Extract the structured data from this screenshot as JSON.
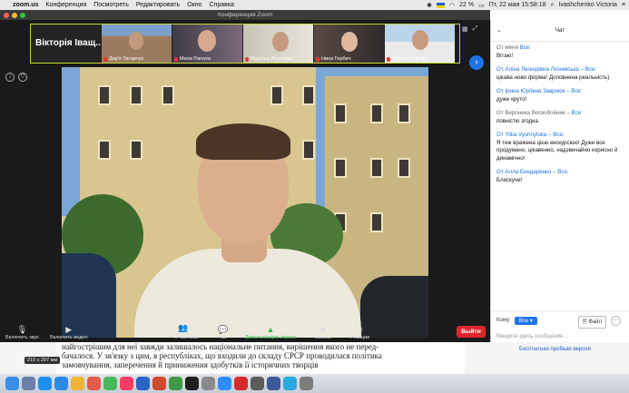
{
  "menubar": {
    "app": "zoom.us",
    "items": [
      "Конференция",
      "Посмотреть",
      "Редактировать",
      "Окно",
      "Справка"
    ],
    "battery": "22 %",
    "datetime": "Пт, 22 мая  15:58:18",
    "user": "Ivashchenko Victoria"
  },
  "window": {
    "title": "Конференция Zoom"
  },
  "participants": [
    {
      "name": "Вікторія Іващ..."
    },
    {
      "name": "Дар'я Татарчук"
    },
    {
      "name": "Maria Panova"
    },
    {
      "name": "Мар'яна Ангелова"
    },
    {
      "name": "Нина Гербич"
    },
    {
      "name": "Bohdan Vakuliuk"
    }
  ],
  "controls": {
    "audio": "Включить звук",
    "video": "Включить видео",
    "participants": "Участники",
    "participants_count": "49",
    "chat": "Чат",
    "share": "Демонстрация экрана",
    "record": "Запись",
    "reactions": "Реакции",
    "leave": "Выйти"
  },
  "chat": {
    "title": "Чат",
    "messages": [
      {
        "from": "От меня",
        "to": "Все:",
        "text": "Вітаю!"
      },
      {
        "from": "От Аліна Леонідівна Лісневська",
        "to": "– Все:",
        "text": "цікава ново форма! Доповнена реальність)"
      },
      {
        "from": "От Ірина Юріївна Закрнюк",
        "to": "– Все:",
        "text": "дуже круто!"
      },
      {
        "from": "От Вероника Воскобойник",
        "to": "– Все:",
        "text": "повністю згодна"
      },
      {
        "from": "От Yiliia Vyshnytska",
        "to": "– Все:",
        "text": "Я теж вражена цією екскурсією! Дуже все продумано, цікавенно, надзвичайно корисно й динамічно!"
      },
      {
        "from": "От Алла Бондаренко",
        "to": "– Все:",
        "text": "Блискуче!"
      }
    ],
    "to_label": "Кому:",
    "to_value": "Все",
    "file_button": "Файл",
    "more": "···",
    "placeholder": "Введите здесь сообщение..."
  },
  "document": {
    "lines": [
      "найгострішим для неї завжди залишалось національне питання, вирішення якого не перед-",
      "бачалося. У зв'язку з цим, в республіках, що входили до складу СРСР проводилася політика",
      "замовчування, заперечення й принижения здобутків її історичних творців"
    ],
    "size_badge": "210 x 297 мм",
    "trial_link": "Бесплатная пробная версия"
  },
  "colors": {
    "accent": "#1f73e8",
    "leave": "#e0242d",
    "share": "#2cc44a",
    "highlight": "#c9d535"
  }
}
